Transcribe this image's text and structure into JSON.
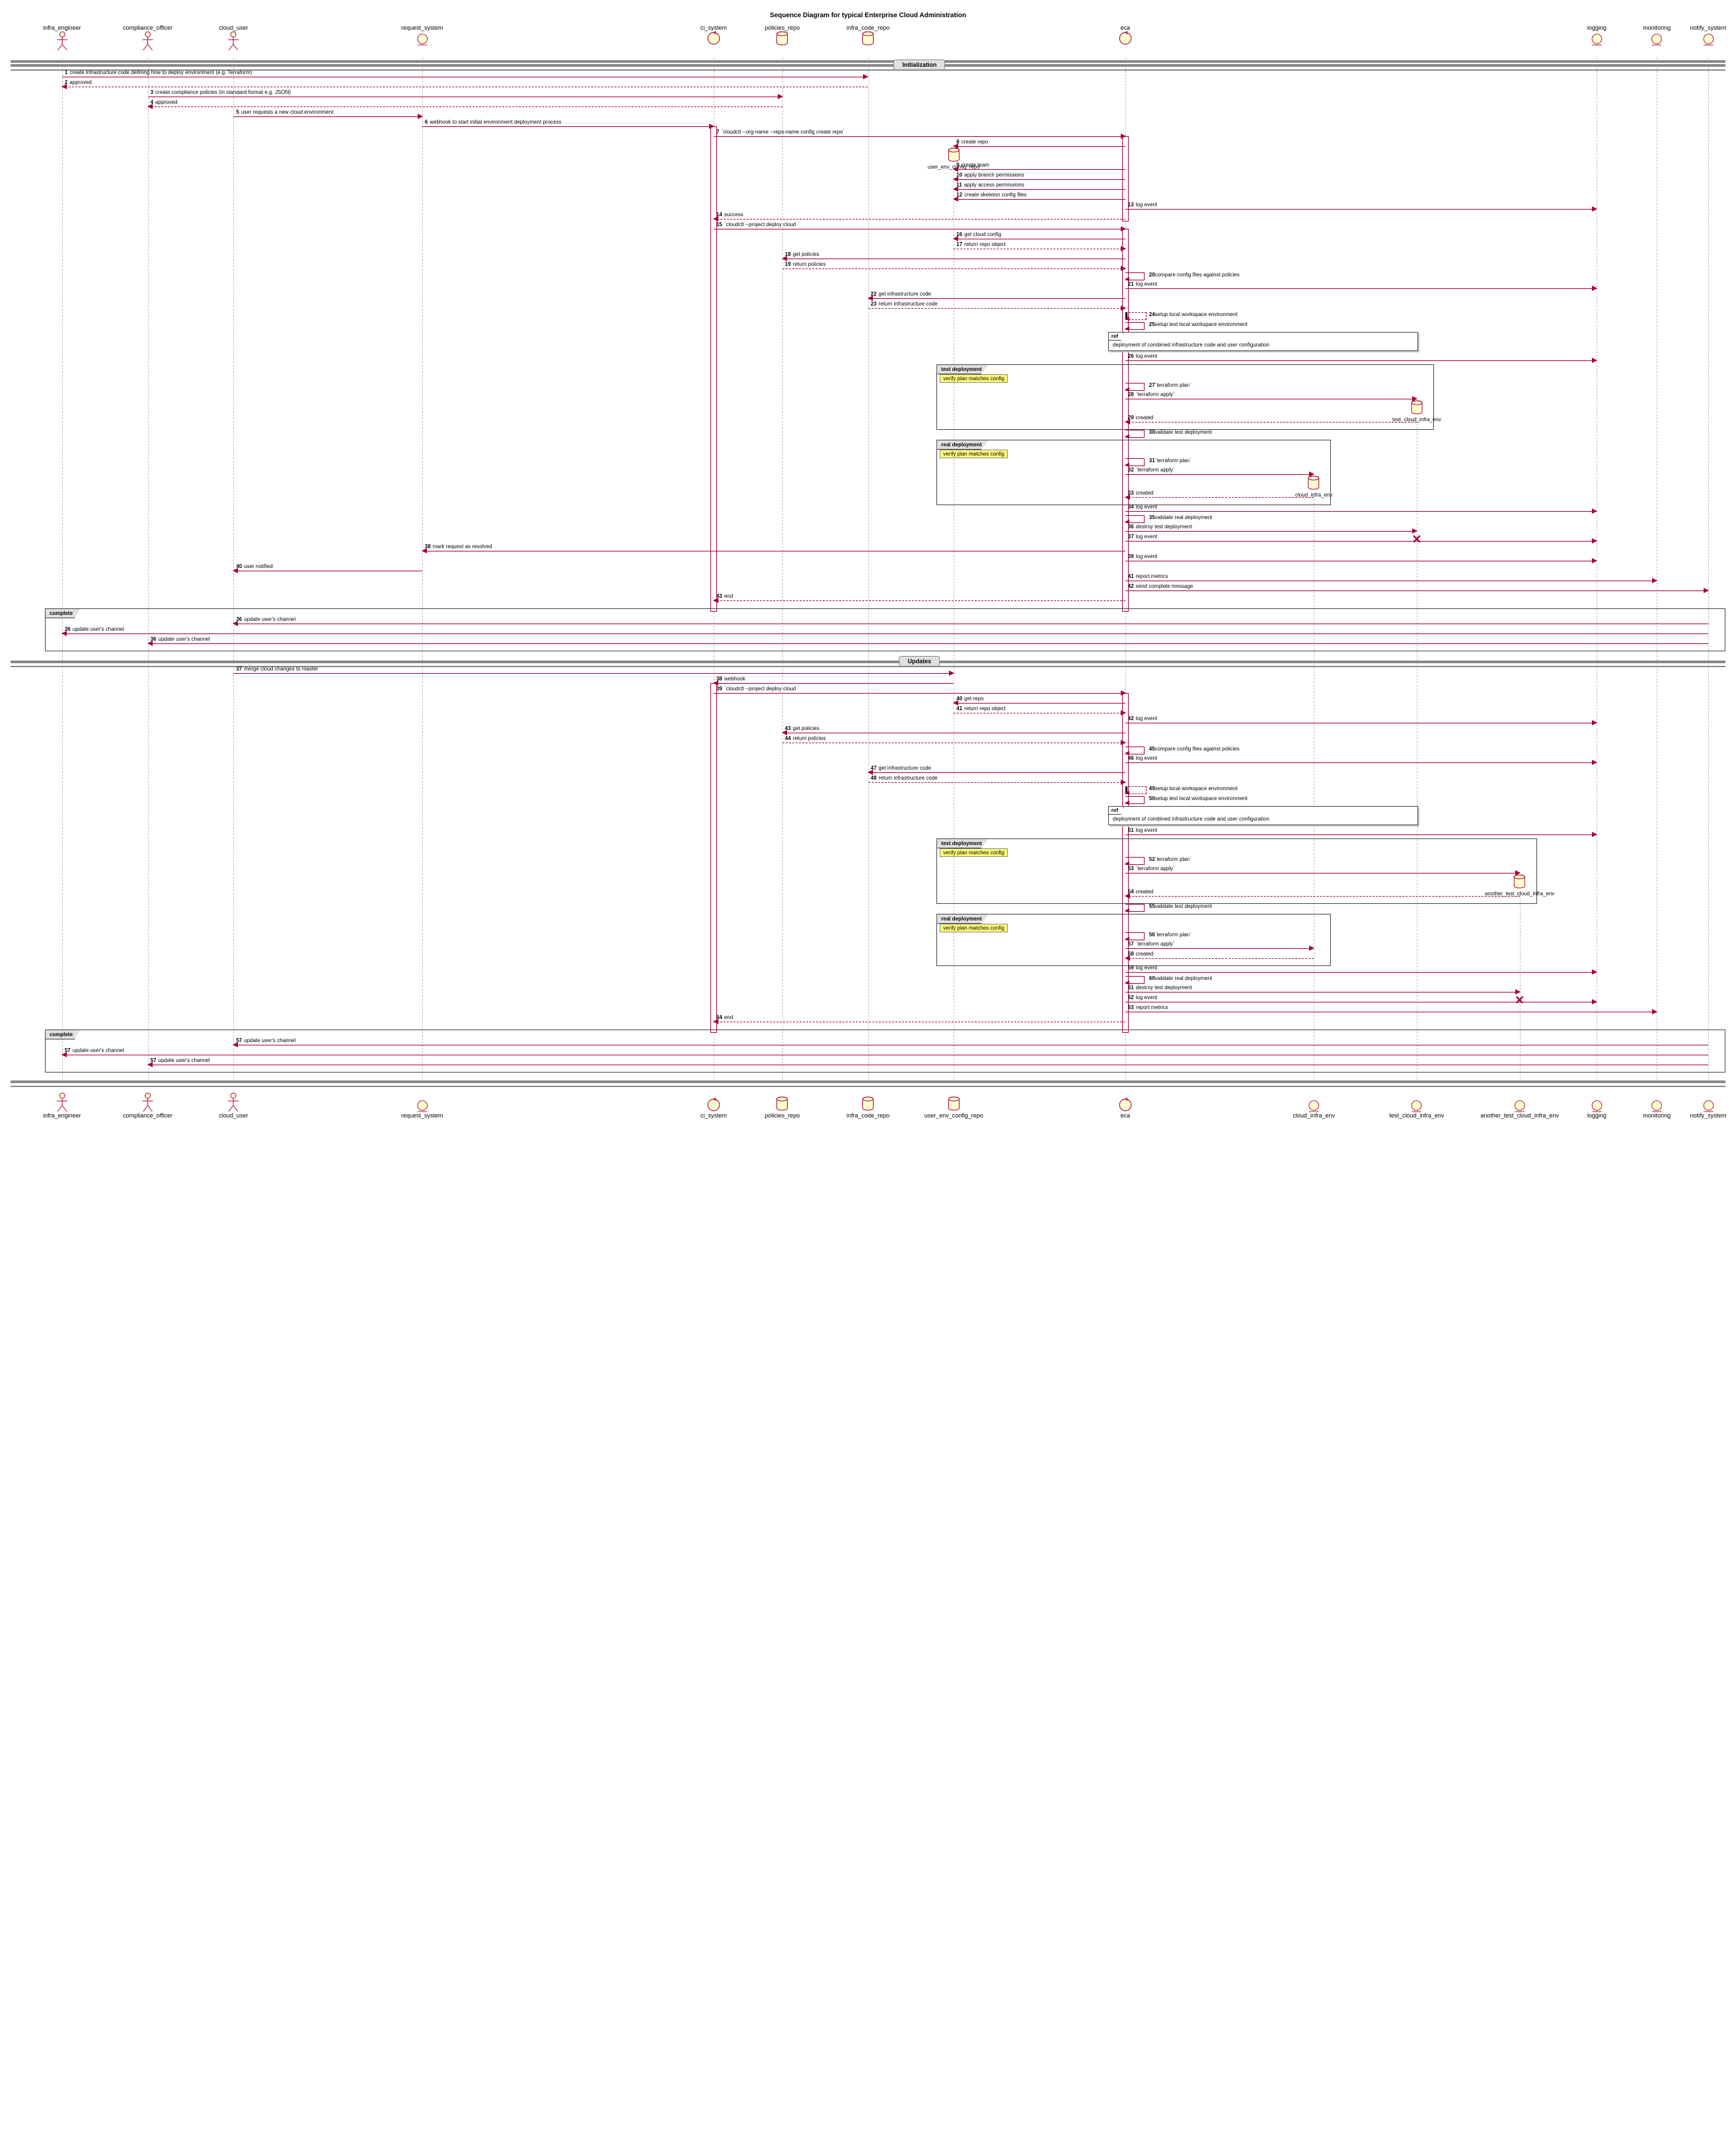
{
  "title": "Sequence Diagram for typical Enterprise Cloud Administration",
  "participants_top": [
    {
      "key": "infra",
      "label": "infra_engineer",
      "kind": "actor"
    },
    {
      "key": "compl",
      "label": "compliance_officer",
      "kind": "actor"
    },
    {
      "key": "user",
      "label": "cloud_user",
      "kind": "actor"
    },
    {
      "key": "req",
      "label": "request_system",
      "kind": "entity"
    },
    {
      "key": "ci",
      "label": "ci_system",
      "kind": "ctrl"
    },
    {
      "key": "pol",
      "label": "policies_repo",
      "kind": "db"
    },
    {
      "key": "infrarep",
      "label": "infra_code_repo",
      "kind": "db"
    },
    {
      "key": "eca",
      "label": "eca",
      "kind": "ctrl"
    },
    {
      "key": "log",
      "label": "logging",
      "kind": "entity"
    },
    {
      "key": "mon",
      "label": "monitoring",
      "kind": "entity"
    },
    {
      "key": "not",
      "label": "notify_system",
      "kind": "entity"
    }
  ],
  "participants_bottom": [
    {
      "key": "infra",
      "label": "infra_engineer",
      "kind": "actor"
    },
    {
      "key": "compl",
      "label": "compliance_officer",
      "kind": "actor"
    },
    {
      "key": "user",
      "label": "cloud_user",
      "kind": "actor"
    },
    {
      "key": "req",
      "label": "request_system",
      "kind": "entity"
    },
    {
      "key": "ci",
      "label": "ci_system",
      "kind": "ctrl"
    },
    {
      "key": "pol",
      "label": "policies_repo",
      "kind": "db"
    },
    {
      "key": "infrarep",
      "label": "infra_code_repo",
      "kind": "db"
    },
    {
      "key": "uenv",
      "label": "user_env_config_repo",
      "kind": "db"
    },
    {
      "key": "eca",
      "label": "eca",
      "kind": "ctrl"
    },
    {
      "key": "cloud",
      "label": "cloud_infra_env",
      "kind": "entity"
    },
    {
      "key": "tcloud",
      "label": "test_cloud_infra_env",
      "kind": "entity"
    },
    {
      "key": "atcloud",
      "label": "another_test_cloud_infra_env",
      "kind": "entity"
    },
    {
      "key": "log",
      "label": "logging",
      "kind": "entity"
    },
    {
      "key": "mon",
      "label": "monitoring",
      "kind": "entity"
    },
    {
      "key": "not",
      "label": "notify_system",
      "kind": "entity"
    }
  ],
  "section_init": "Initialization",
  "section_upd": "Updates",
  "ref_text": "deployment of combined infrastructure code and user configuration",
  "grp_test": "test deployment",
  "grp_real": "real deployment",
  "grp_complete": "complete",
  "crit_lbl": "verify plan matches config",
  "created_uenv": "user_env_config_repo",
  "created_tcloud": "test_cloud_infra_env",
  "created_cloud": "cloud_infra_env",
  "created_atcloud": "another_test_cloud_infra_env",
  "steps_init": {
    "1": "create infrastructure code defining how to deploy environment (e.g. Terraform)",
    "2": "approved",
    "3": "create compliance policies (in standard format e.g. JSON)",
    "4": "approved",
    "5": "user requests a new cloud environment",
    "6": "webhook to start initial environment deployment process",
    "7": "`cloudctl --org-name <org> --repo-name <repo> config create repo`",
    "8": "create repo",
    "9": "create team",
    "10": "apply branch permissions",
    "11": "apply access permissions",
    "12": "create skeleton config files",
    "13": "log event",
    "14": "success",
    "15": "`cloudctl --project <project> deploy cloud <cloud>`",
    "16": "get cloud config",
    "17": "return repo object",
    "18": "get policies",
    "19": "return policies",
    "20": "compare config files against policies",
    "21": "log event",
    "22": "get infrastructure code",
    "23": "return infrastructure code",
    "24": "setup local workspace environment",
    "25": "setup test local workspace environment",
    "26": "log event",
    "27": "`terraform plan`",
    "28": "`terraform apply`",
    "29": "created",
    "30": "validate test deployment",
    "31": "`terraform plan`",
    "32": "`terraform apply`",
    "33": "created",
    "34": "log event",
    "35": "validate real deployment",
    "36": "destroy test deployment",
    "37": "log event",
    "38": "mark request as resolved",
    "39": "log event",
    "40": "user notified",
    "41": "report metrics",
    "42": "send complete message",
    "43": "end"
  },
  "par_36_init": "update user's channel",
  "steps_upd": {
    "37": "merge cloud changes to master",
    "38": "webhook",
    "39": "`cloudctl --project <project> deploy cloud <cloud>`",
    "40": "get repo",
    "41": "return repo object",
    "42": "log event",
    "43": "get policies",
    "44": "return policies",
    "45": "compare config files against policies",
    "46": "log event",
    "47": "get infrastructure code",
    "48": "return infrastructure code",
    "49": "setup local workspace environment",
    "50": "setup test local workspace environment",
    "51": "log event",
    "52": "`terraform plan`",
    "53": "`terraform apply`",
    "54": "created",
    "55": "validate test deployment",
    "56": "`terraform plan`",
    "57": "`terraform apply`",
    "58": "created",
    "59": "log event",
    "60": "validate real deployment",
    "61": "destroy test deployment",
    "62": "log event",
    "63": "report metrics",
    "64": "end"
  },
  "par_57_upd": "update user's channel"
}
